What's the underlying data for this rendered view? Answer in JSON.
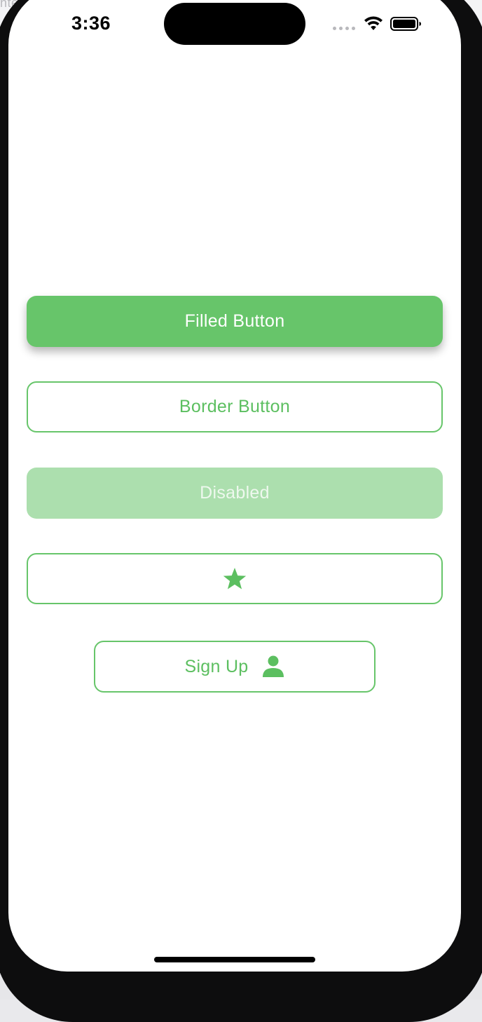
{
  "background": {
    "partial_text": "ntent"
  },
  "status_bar": {
    "time": "3:36",
    "icons": [
      "cellular-dots-icon",
      "wifi-icon",
      "battery-icon"
    ]
  },
  "buttons": {
    "filled_label": "Filled Button",
    "border_label": "Border Button",
    "disabled_label": "Disabled",
    "star_icon": "star-icon",
    "signup_label": "Sign Up",
    "signup_icon": "person-icon"
  },
  "colors": {
    "accent": "#67c56a",
    "accent_text": "#5cbf60",
    "disabled_fill": "#acdfae",
    "disabled_text": "#eef8ee"
  }
}
